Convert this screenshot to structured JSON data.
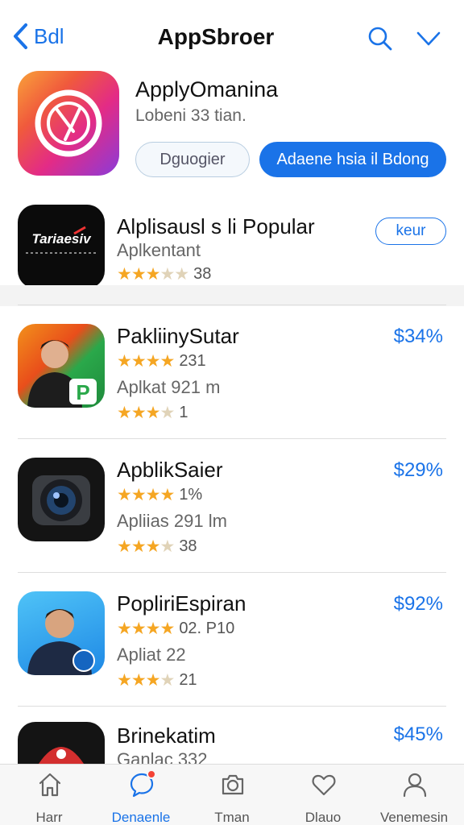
{
  "nav": {
    "back_label": "Bdl",
    "title": "AppSbroer"
  },
  "featured": {
    "title": "ApplyOmanina",
    "subtitle": "Lobeni 33 tian.",
    "secondary_button": "Dguogier",
    "primary_button": "Adaene hsia il Bdong"
  },
  "apps": [
    {
      "title": "Alplisausl s li Popular",
      "subtitle": "Aplkentant",
      "rating_stars": 3.5,
      "rating_text": "38",
      "action_label": "keur",
      "icon_text": "Tariaesiv"
    },
    {
      "title": "PakliinySutar",
      "rating1_stars": 4,
      "rating1_text": "231",
      "subtitle": "Aplkat 921 m",
      "rating2_stars": 3.5,
      "rating2_text": "1",
      "price": "$34%",
      "icon_text": "P"
    },
    {
      "title": "ApblikSaier",
      "rating1_stars": 4,
      "rating1_text": "1%",
      "subtitle": "Apliias 291 lm",
      "rating2_stars": 3.5,
      "rating2_text": "38",
      "price": "$29%"
    },
    {
      "title": "PopliriEspiran",
      "rating1_stars": 4,
      "rating1_text": "02. P10",
      "subtitle": "Apliat 22",
      "rating2_stars": 3.5,
      "rating2_text": "21",
      "price": "$92%"
    },
    {
      "title": "Brinekatim",
      "subtitle": "Ganlac 332",
      "price": "$45%"
    }
  ],
  "tabs": [
    {
      "label": "Harr",
      "icon": "home-icon"
    },
    {
      "label": "Denaenle",
      "icon": "chat-icon"
    },
    {
      "label": "Tman",
      "icon": "camera-icon"
    },
    {
      "label": "Dlauo",
      "icon": "heart-icon"
    },
    {
      "label": "Venemesin",
      "icon": "person-icon"
    }
  ],
  "colors": {
    "accent": "#1a73e8",
    "star": "#f5a623",
    "badge": "#f44336"
  }
}
